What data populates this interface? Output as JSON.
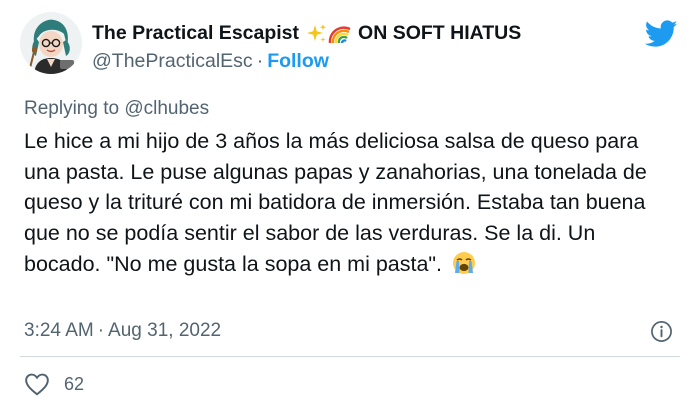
{
  "tweet": {
    "display_name": "The Practical Escapist",
    "name_suffix": "ON SOFT HIATUS",
    "handle": "@ThePracticalEsc",
    "separator": "·",
    "follow_label": "Follow",
    "replying_prefix": "Replying to",
    "replying_to": "@clhubes",
    "text": "Le hice a mi hijo de 3 años la más deliciosa salsa de queso para una pasta. Le puse algunas papas y zanahorias, una tonelada de queso y la trituré con mi batidora de inmersión. Estaba tan buena que no se podía sentir el sabor de las verduras. Se la di. Un bocado. \"No me gusta la sopa en mi pasta\".",
    "time": "3:24 AM",
    "date": "Aug 31, 2022",
    "like_count": "62"
  },
  "icons": {
    "avatar": "cartoon-avatar-icon",
    "sparkles": "sparkles-icon",
    "rainbow": "rainbow-icon",
    "platform": "twitter-bird-icon",
    "emoji": "loudly-crying-face-icon",
    "info": "info-icon",
    "like": "heart-icon"
  },
  "colors": {
    "accent": "#1d9bf0",
    "secondary_text": "#536471",
    "divider": "#cfd9de"
  }
}
